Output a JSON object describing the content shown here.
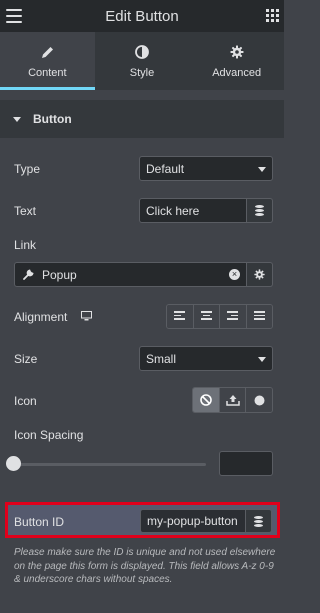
{
  "header": {
    "title": "Edit Button",
    "menu_icon": "hamburger-menu-icon",
    "apps_icon": "grid-apps-icon"
  },
  "tabs": [
    {
      "label": "Content",
      "icon": "pencil-icon",
      "active": true
    },
    {
      "label": "Style",
      "icon": "half-circle-contrast-icon",
      "active": false
    },
    {
      "label": "Advanced",
      "icon": "gear-icon",
      "active": false
    }
  ],
  "section": {
    "label": "Button",
    "expanded": true
  },
  "fields": {
    "type": {
      "label": "Type",
      "value": "Default"
    },
    "text": {
      "label": "Text",
      "value": "Click here"
    },
    "link": {
      "label": "Link",
      "value": "Popup"
    },
    "alignment": {
      "label": "Alignment",
      "options": [
        "left",
        "center",
        "right",
        "justify"
      ]
    },
    "size": {
      "label": "Size",
      "value": "Small"
    },
    "icon": {
      "label": "Icon",
      "options": [
        "none",
        "upload",
        "svg"
      ],
      "selected": "none"
    },
    "icon_spacing": {
      "label": "Icon Spacing",
      "value": ""
    },
    "button_id": {
      "label": "Button ID",
      "value": "my-popup-button"
    }
  },
  "note": "Please make sure the ID is unique and not used elsewhere on the page this form is displayed. This field allows A-z 0-9 & underscore chars without spaces.",
  "colors": {
    "accent": "#71d7f7",
    "highlight_border": "#e0001b",
    "panel_bg": "#404349",
    "header_bg": "#26292c"
  }
}
